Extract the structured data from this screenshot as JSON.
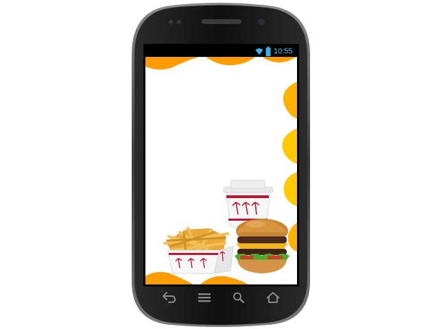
{
  "status_bar": {
    "time": "10:55",
    "wifi_icon": "wifi-icon",
    "battery_icon": "battery-icon",
    "accent": "#33b5e5"
  },
  "navigation_bar": {
    "buttons": [
      {
        "name": "back",
        "icon": "back-icon"
      },
      {
        "name": "menu",
        "icon": "menu-icon"
      },
      {
        "name": "search",
        "icon": "search-icon"
      },
      {
        "name": "home",
        "icon": "home-icon"
      }
    ]
  },
  "screen": {
    "background": "#ffffff",
    "wave_colors": [
      "#ff9d00",
      "#ffc800"
    ],
    "food_image": "fast-food-meal"
  }
}
